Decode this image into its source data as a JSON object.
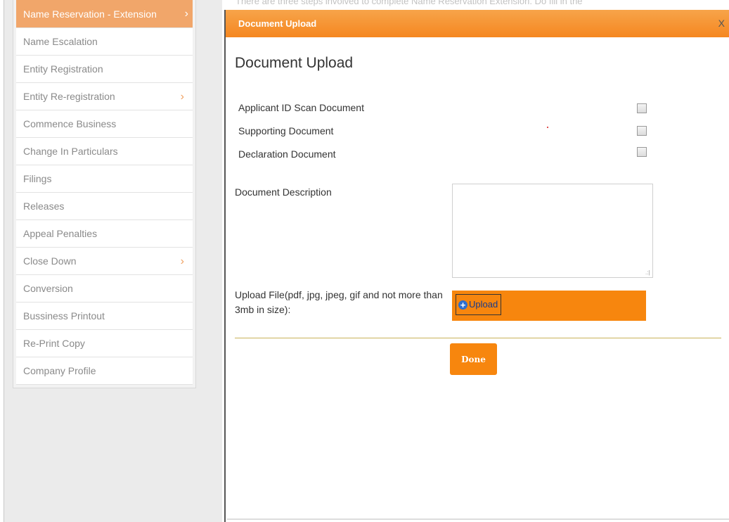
{
  "background_text": "There are three steps involved to complete Name Reservation Extension. Do fill in the",
  "sidebar": {
    "items": [
      {
        "label": "Name Reservation - Extension",
        "active": true,
        "has_submenu": true
      },
      {
        "label": "Name Escalation"
      },
      {
        "label": "Entity Registration"
      },
      {
        "label": "Entity Re-registration",
        "has_submenu": true
      },
      {
        "label": "Commence Business"
      },
      {
        "label": "Change In Particulars"
      },
      {
        "label": "Filings"
      },
      {
        "label": "Releases"
      },
      {
        "label": "Appeal Penalties"
      },
      {
        "label": "Close Down",
        "has_submenu": true
      },
      {
        "label": "Conversion"
      },
      {
        "label": "Bussiness Printout"
      },
      {
        "label": "Re-Print Copy"
      },
      {
        "label": "Company Profile"
      }
    ],
    "chevron": "›"
  },
  "dialog": {
    "header_title": "Document Upload",
    "close_label": "X",
    "title": "Document Upload",
    "documents": [
      {
        "label": "Applicant ID Scan Document",
        "checked": false
      },
      {
        "label": "Supporting Document",
        "checked": false
      },
      {
        "label": "Declaration Document",
        "checked": false
      }
    ],
    "description_label": "Document Description",
    "description_value": "",
    "upload_label": "Upload File(pdf, jpg, jpeg, gif and not more than 3mb in size):",
    "upload_button_label": "Upload",
    "done_label": "Done"
  },
  "colors": {
    "accent": "#f7860e",
    "active_menu": "#f1a66a",
    "divider": "#c9b25a"
  }
}
